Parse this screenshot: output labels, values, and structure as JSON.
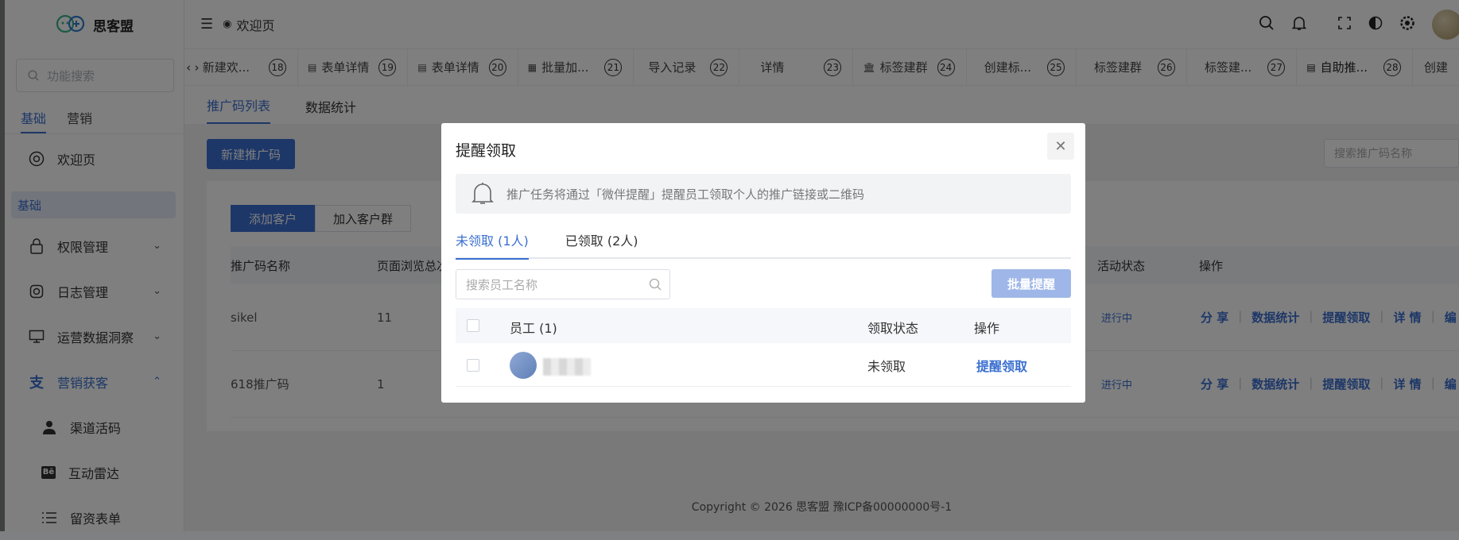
{
  "app": {
    "name": "思客盟",
    "brand_color": "#3a6fd0"
  },
  "sidebar": {
    "search_placeholder": "功能搜索",
    "tabs": [
      "基础",
      "营销"
    ],
    "welcome": "欢迎页",
    "group_label": "基础",
    "items": [
      {
        "label": "权限管理",
        "icon": "lock-icon"
      },
      {
        "label": "日志管理",
        "icon": "instagram-icon"
      },
      {
        "label": "运营数据洞察",
        "icon": "monitor-icon"
      },
      {
        "label": "营销获客",
        "icon": "alipay-icon"
      }
    ],
    "sub_items": [
      {
        "label": "渠道活码",
        "icon": "user-icon"
      },
      {
        "label": "互动雷达",
        "icon": "behance-icon"
      },
      {
        "label": "留资表单",
        "icon": "list-icon"
      }
    ]
  },
  "topbar": {
    "welcome_tab": "欢迎页"
  },
  "tabs": [
    {
      "label": "新建欢...",
      "num": "18"
    },
    {
      "label": "表单详情",
      "num": "19"
    },
    {
      "label": "表单详情",
      "num": "20"
    },
    {
      "label": "批量加...",
      "num": "21"
    },
    {
      "label": "导入记录",
      "num": "22"
    },
    {
      "label": "详情",
      "num": "23"
    },
    {
      "label": "标签建群",
      "num": "24"
    },
    {
      "label": "创建标...",
      "num": "25"
    },
    {
      "label": "标签建群",
      "num": "26"
    },
    {
      "label": "标签建...",
      "num": "27"
    },
    {
      "label": "自助推...",
      "num": "28"
    },
    {
      "label": "创建",
      "num": ""
    }
  ],
  "page": {
    "subtabs": [
      "推广码列表",
      "数据统计"
    ],
    "new_button": "新建推广码",
    "search_placeholder": "搜索推广码名称",
    "segments": [
      "添加客户",
      "加入客户群"
    ],
    "columns": {
      "name": "推广码名称",
      "views": "页面浏览总次",
      "status": "活动状态",
      "ops": "操作"
    },
    "rows": [
      {
        "name": "sikel",
        "views": "11",
        "status": "进行中"
      },
      {
        "name": "618推广码",
        "views": "1",
        "status": "进行中"
      }
    ],
    "ops": [
      "分 享",
      "数据统计",
      "提醒领取",
      "详 情",
      "编"
    ],
    "footer": "Copyright © 2026 思客盟 豫ICP备00000000号-1"
  },
  "modal": {
    "title": "提醒领取",
    "notice": "推广任务将通过「微伴提醒」提醒员工领取个人的推广链接或二维码",
    "tabs": [
      "未领取 (1人)",
      "已领取 (2人)"
    ],
    "search_placeholder": "搜索员工名称",
    "batch_button": "批量提醒",
    "columns": {
      "employee": "员工 (1)",
      "status": "领取状态",
      "ops": "操作"
    },
    "rows": [
      {
        "status": "未领取",
        "action": "提醒领取"
      }
    ]
  }
}
